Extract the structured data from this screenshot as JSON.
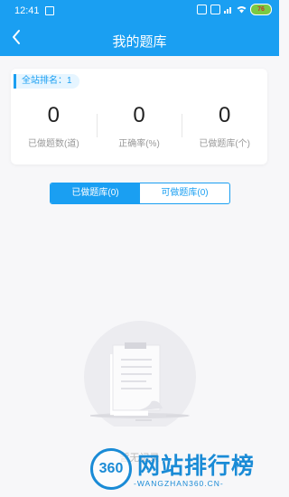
{
  "status_bar": {
    "time": "12:41",
    "battery": "76"
  },
  "header": {
    "title": "我的题库"
  },
  "summary": {
    "rank_label": "全站排名：1",
    "stats": [
      {
        "value": "0",
        "label": "已做题数(道)"
      },
      {
        "value": "0",
        "label": "正确率(%)"
      },
      {
        "value": "0",
        "label": "已做题库(个)"
      }
    ]
  },
  "tabs": [
    {
      "label": "已做题库(0)",
      "active": true
    },
    {
      "label": "可做题库(0)",
      "active": false
    }
  ],
  "empty_state": {
    "text": "暂无记录"
  },
  "watermark": {
    "logo_text": "360",
    "title": "网站排行榜",
    "subtitle": "-WANGZHAN360.CN-"
  },
  "colors": {
    "accent": "#1a9ff2",
    "watermark": "#1a8bd6"
  }
}
